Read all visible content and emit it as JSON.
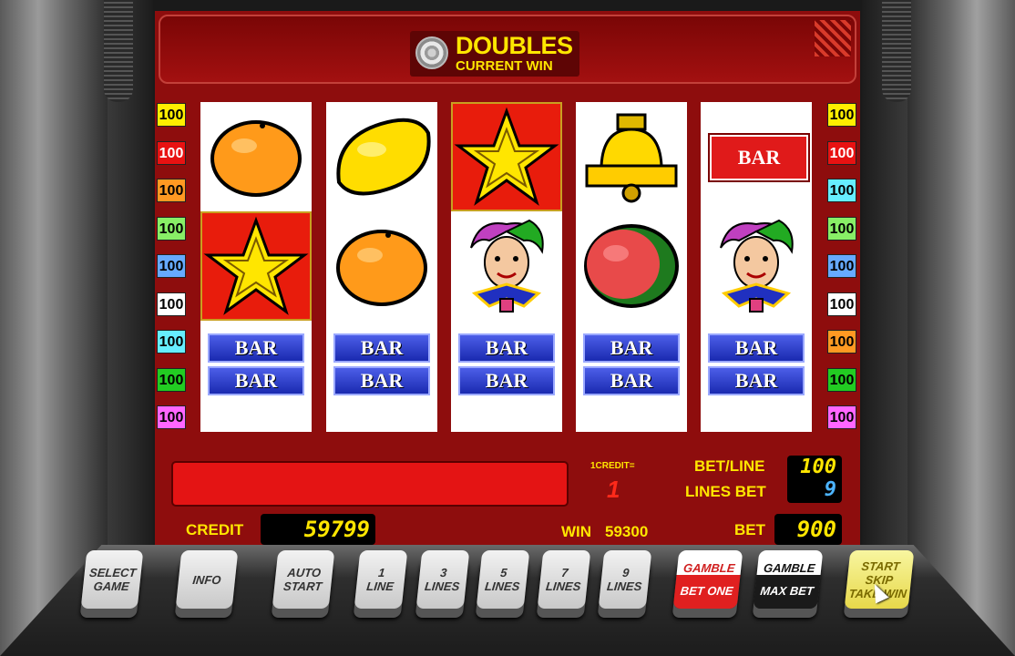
{
  "title": {
    "main": "DOUBLES",
    "sub": "CURRENT WIN"
  },
  "paylines": {
    "left": [
      {
        "value": "100",
        "color": "#ffee00"
      },
      {
        "value": "100",
        "color": "#e81212"
      },
      {
        "value": "100",
        "color": "#ff9922"
      },
      {
        "value": "100",
        "color": "#88ee66"
      },
      {
        "value": "100",
        "color": "#66aaff"
      },
      {
        "value": "100",
        "color": "#ffffff"
      },
      {
        "value": "100",
        "color": "#66eeff"
      },
      {
        "value": "100",
        "color": "#22cc22"
      },
      {
        "value": "100",
        "color": "#ff66ff"
      }
    ],
    "right": [
      {
        "value": "100",
        "color": "#ffee00"
      },
      {
        "value": "100",
        "color": "#e81212"
      },
      {
        "value": "100",
        "color": "#66eeff"
      },
      {
        "value": "100",
        "color": "#88ee66"
      },
      {
        "value": "100",
        "color": "#66aaff"
      },
      {
        "value": "100",
        "color": "#ffffff"
      },
      {
        "value": "100",
        "color": "#ff9922"
      },
      {
        "value": "100",
        "color": "#22cc22"
      },
      {
        "value": "100",
        "color": "#ff66ff"
      }
    ]
  },
  "reels": [
    [
      "orange",
      "star",
      "bar-double"
    ],
    [
      "lemon",
      "orange",
      "bar-double"
    ],
    [
      "star",
      "jester",
      "bar-double"
    ],
    [
      "bell",
      "watermelon",
      "bar-double"
    ],
    [
      "bar-red",
      "jester",
      "bar-double"
    ]
  ],
  "bar_label": "BAR",
  "info": {
    "credit_rate_label": "1CREDIT=",
    "credit_rate_value": "1",
    "bet_line_label": "BET/LINE",
    "bet_line_value": "100",
    "lines_bet_label": "LINES BET",
    "lines_bet_value": "9",
    "credit_label": "CREDIT",
    "credit_value": "59799",
    "win_label": "WIN",
    "win_value": "59300",
    "bet_label": "BET",
    "bet_value": "900"
  },
  "buttons": [
    {
      "l1": "SELECT",
      "l2": "GAME",
      "style": "plain"
    },
    {
      "l1": "INFO",
      "l2": "",
      "style": "plain"
    },
    {
      "l1": "AUTO",
      "l2": "START",
      "style": "plain"
    },
    {
      "l1": "1",
      "l2": "LINE",
      "style": "plain"
    },
    {
      "l1": "3",
      "l2": "LINES",
      "style": "plain"
    },
    {
      "l1": "5",
      "l2": "LINES",
      "style": "plain"
    },
    {
      "l1": "7",
      "l2": "LINES",
      "style": "plain"
    },
    {
      "l1": "9",
      "l2": "LINES",
      "style": "plain"
    },
    {
      "l1": "GAMBLE",
      "l2": "BET ONE",
      "style": "red"
    },
    {
      "l1": "GAMBLE",
      "l2": "MAX BET",
      "style": "black"
    },
    {
      "l1": "START",
      "l2": "SKIP",
      "l3": "TAKE WIN",
      "style": "yellow"
    }
  ]
}
